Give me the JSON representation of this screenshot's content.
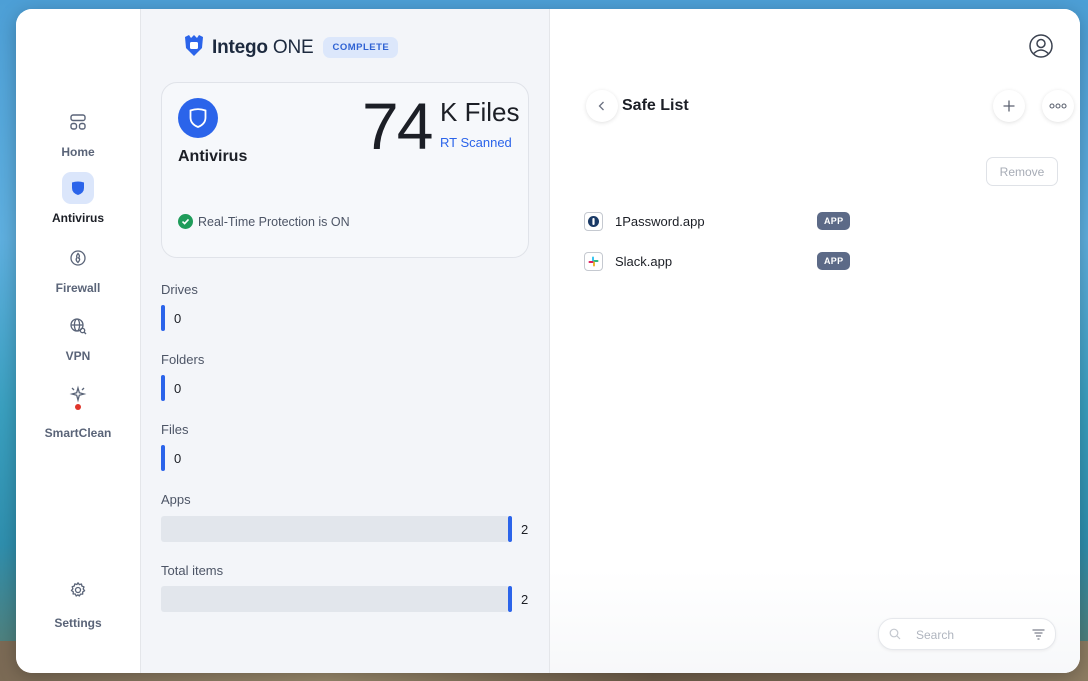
{
  "app": {
    "brand_name": "Intego ONE",
    "brand_bold": "Intego",
    "brand_rest": " ONE",
    "plan_badge": "COMPLETE"
  },
  "sidebar": {
    "items": [
      {
        "label": "Home",
        "icon": "home-icon",
        "active": false
      },
      {
        "label": "Antivirus",
        "icon": "shield-icon",
        "active": true
      },
      {
        "label": "Firewall",
        "icon": "firewall-icon",
        "active": false
      },
      {
        "label": "VPN",
        "icon": "globe-icon",
        "active": false
      },
      {
        "label": "SmartClean",
        "icon": "sparkle-icon",
        "active": false,
        "notification_dot": true
      }
    ],
    "settings_label": "Settings"
  },
  "antivirus": {
    "title": "Antivirus",
    "scanned_number": "74",
    "scanned_unit": "K Files",
    "scanned_caption": "RT Scanned",
    "protection_status": "Real-Time Protection is ON"
  },
  "stats": [
    {
      "label": "Drives",
      "value": "0"
    },
    {
      "label": "Folders",
      "value": "0"
    },
    {
      "label": "Files",
      "value": "0"
    },
    {
      "label": "Apps",
      "value": "2"
    },
    {
      "label": "Total items",
      "value": "2"
    }
  ],
  "safe_list": {
    "title": "Safe List",
    "remove_label": "Remove",
    "items": [
      {
        "name": "1Password.app",
        "type": "APP",
        "icon": "1password-icon"
      },
      {
        "name": "Slack.app",
        "type": "APP",
        "icon": "slack-icon"
      }
    ],
    "search_placeholder": "Search"
  },
  "colors": {
    "accent": "#2b64ea",
    "success": "#1f9c5a",
    "badge": "#5c6a87",
    "alert_dot": "#e0352b"
  }
}
